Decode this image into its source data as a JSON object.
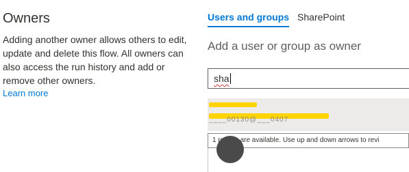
{
  "owners": {
    "title": "Owners",
    "description": "Adding another owner allows others to edit, update and delete this flow. All owners can also access the run history and add or remove other owners.",
    "learn_more": "Learn more"
  },
  "tabs": [
    {
      "label": "Users and groups",
      "active": true
    },
    {
      "label": "SharePoint",
      "active": false
    }
  ],
  "add_owner": {
    "heading": "Add a user or group as owner",
    "search_value": "sha"
  },
  "suggestions": {
    "redacted_fragment": "____00130@___0407"
  },
  "status": {
    "text": "1 results are available. Use up and down arrows to revi"
  },
  "colors": {
    "accent": "#0078d4",
    "redaction": "#ffd400"
  },
  "icons": {
    "avatar": "user-avatar-icon"
  }
}
